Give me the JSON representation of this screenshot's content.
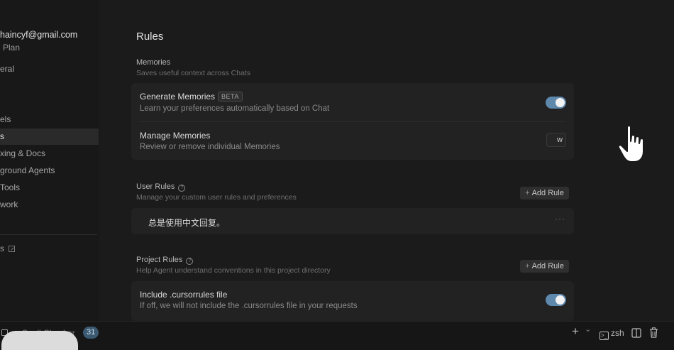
{
  "account": {
    "email": "haincyf@gmail.com",
    "plan": "Plan"
  },
  "sidebar": {
    "items": [
      {
        "label": "eral"
      },
      {
        "label": "els"
      },
      {
        "label": "s"
      },
      {
        "label": "xing & Docs"
      },
      {
        "label": "ground Agents"
      },
      {
        "label": " Tools"
      },
      {
        "label": "work"
      }
    ],
    "footer_link": "s"
  },
  "page": {
    "title": "Rules"
  },
  "memories": {
    "title": "Memories",
    "subtitle": "Saves useful context across Chats",
    "generate": {
      "title": "Generate Memories",
      "badge": "BETA",
      "desc": "Learn your preferences automatically based on Chat",
      "enabled": true
    },
    "manage": {
      "title": "Manage Memories",
      "desc": "Review or remove individual Memories",
      "button": "w"
    }
  },
  "user_rules": {
    "title": "User Rules",
    "help": "?",
    "subtitle": "Manage your custom user rules and preferences",
    "add_label": "Add Rule",
    "rules": [
      {
        "text": "总是使用中文回复。",
        "menu": "···"
      }
    ]
  },
  "project_rules": {
    "title": "Project Rules",
    "help": "?",
    "subtitle": "Help Agent understand conventions in this project directory",
    "add_label": "Add Rule",
    "cursorrules": {
      "title": "Include .cursorrules file",
      "desc": "If off, we will not include the .cursorrules file in your requests",
      "enabled": true
    }
  },
  "statusbar": {
    "spell_checker": "Spell Checker",
    "count": "31",
    "plus": "+",
    "chevron": "⌄",
    "terminal_label": "zsh",
    "terminal_glyph": ">_"
  },
  "colors": {
    "toggle_on": "#5f88ad",
    "badge_count": "#3b5a72"
  }
}
